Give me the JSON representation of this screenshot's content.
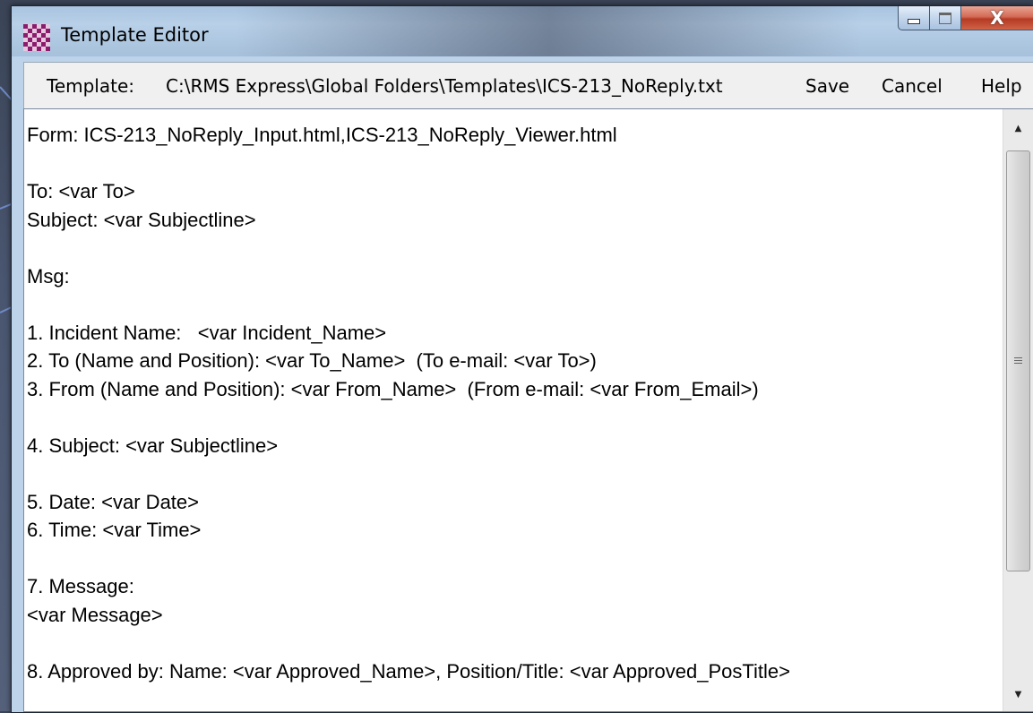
{
  "window": {
    "title": "Template Editor",
    "icon": "checkered-app-icon",
    "controls": {
      "minimize": "minimize-icon",
      "maximize": "maximize-icon",
      "close": "close-icon",
      "close_glyph": "X"
    }
  },
  "toolbar": {
    "template_label": "Template:",
    "template_path": "C:\\RMS Express\\Global Folders\\Templates\\ICS-213_NoReply.txt",
    "save_label": "Save",
    "cancel_label": "Cancel",
    "help_label": "Help"
  },
  "editor": {
    "content": "Form: ICS-213_NoReply_Input.html,ICS-213_NoReply_Viewer.html\n\nTo: <var To>\nSubject: <var Subjectline>\n\nMsg:\n\n1. Incident Name:   <var Incident_Name>\n2. To (Name and Position): <var To_Name>  (To e-mail: <var To>)\n3. From (Name and Position): <var From_Name>  (From e-mail: <var From_Email>)\n\n4. Subject: <var Subjectline>\n\n5. Date: <var Date>\n6. Time: <var Time>\n\n7. Message:\n<var Message>\n\n8. Approved by: Name: <var Approved_Name>, Position/Title: <var Approved_PosTitle>",
    "scrollbar": {
      "up_icon": "scroll-up-arrow-icon",
      "down_icon": "scroll-down-arrow-icon",
      "up_glyph": "▲",
      "down_glyph": "▼"
    }
  },
  "colors": {
    "titlebar": "#b8d0e8",
    "close_button": "#c9503a",
    "background": "#4a5670"
  }
}
